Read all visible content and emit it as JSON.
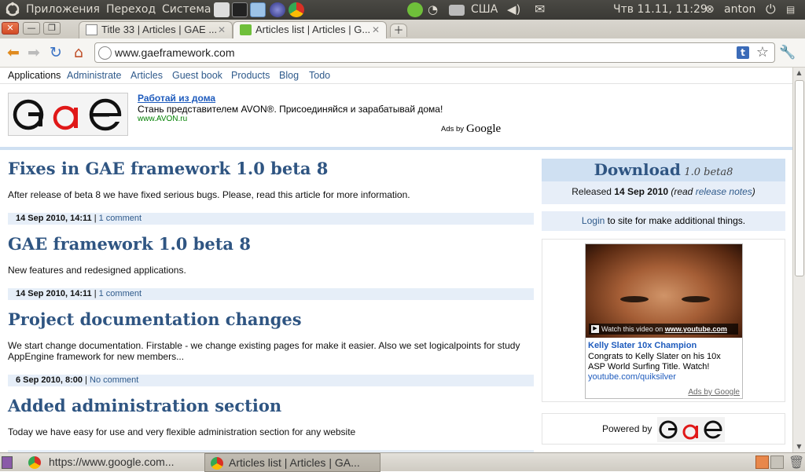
{
  "top_panel": {
    "menus": [
      "Приложения",
      "Переход",
      "Система"
    ],
    "keyboard_layout": "США",
    "datetime": "Чтв 11.11, 11:29",
    "user": "anton"
  },
  "browser": {
    "tabs": [
      {
        "label": "Title 33 | Articles | GAE ..."
      },
      {
        "label": "Articles list | Articles | G..."
      }
    ],
    "url": "www.gaeframework.com",
    "ext_badge": "t"
  },
  "app_nav": {
    "items": [
      "Applications",
      "Administrate",
      "Articles",
      "Guest book",
      "Products",
      "Blog",
      "Todo"
    ]
  },
  "ad": {
    "title": "Работай из дома",
    "text": "Стань представителем AVON®. Присоединяйся и зарабатывай дома!",
    "url": "www.AVON.ru",
    "ads_by": "Ads by",
    "ads_brand": "Google"
  },
  "logo": {
    "text": "GAE"
  },
  "articles": [
    {
      "title": "Fixes in GAE framework 1.0 beta 8",
      "summary": "After release of beta 8 we have fixed serious bugs. Please, read this article for more information.",
      "date": "14 Sep 2010, 14:11",
      "comments": "1 comment"
    },
    {
      "title": "GAE framework 1.0 beta 8",
      "summary": "New features and redesigned applications.",
      "date": "14 Sep 2010, 14:11",
      "comments": "1 comment"
    },
    {
      "title": "Project documentation changes",
      "summary": "We start change documentation. Firstable - we change existing pages for make it easier. Also we set logicalpoints for study AppEngine framework for new members...",
      "date": "6 Sep 2010, 8:00",
      "comments": "No comment"
    },
    {
      "title": "Added administration section",
      "summary": "Today we have easy for use and very flexible administration section for any website"
    }
  ],
  "sidebar": {
    "download_label": "Download",
    "download_version": "1.0 beta8",
    "released_prefix": "Released",
    "released_date": "14 Sep 2010",
    "read_prefix": "(read",
    "release_notes": "release notes",
    "read_suffix": ")",
    "login_link": "Login",
    "login_suffix": "to site for make additional things.",
    "yt_watch_prefix": "Watch this video on",
    "yt_watch_site": "www.youtube.com",
    "yt_headline": "Kelly Slater 10x Champion",
    "yt_description": "Congrats to Kelly Slater on his 10x ASP World Surfing Title. Watch!",
    "yt_link": "youtube.com/quiksilver",
    "yt_ads_by": "Ads by Google",
    "powered_by": "Powered by"
  },
  "taskbar": {
    "items": [
      {
        "label": "https://www.google.com..."
      },
      {
        "label": "Articles list | Articles | GA..."
      }
    ]
  }
}
